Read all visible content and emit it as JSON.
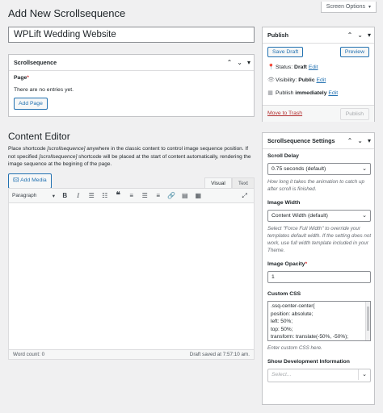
{
  "header": {
    "title": "Add New Scrollsequence",
    "screen_options": "Screen Options"
  },
  "post": {
    "title_value": "WPLift Wedding Website"
  },
  "scrollsequence_box": {
    "title": "Scrollsequence",
    "page_label": "Page",
    "required_mark": "*",
    "empty_text": "There are no entries yet.",
    "add_page_label": "Add Page"
  },
  "content_editor": {
    "title": "Content Editor",
    "help_1": "Place shortcode ",
    "help_code_1": "[scrollsequence]",
    "help_2": " anywhere in the classic content to control image sequence position. If not specified ",
    "help_code_2": "[scrollsequence]",
    "help_3": " shortcode will be placed at the start of content automatically, rendering the image sequence at the begining of the page.",
    "add_media_label": "Add Media",
    "tab_visual": "Visual",
    "tab_text": "Text",
    "format_select": "Paragraph",
    "word_count": "Word count: 0",
    "draft_saved": "Draft saved at 7:57:10 am."
  },
  "publish_box": {
    "title": "Publish",
    "save_draft": "Save Draft",
    "preview": "Preview",
    "status_label": "Status: ",
    "status_value": "Draft",
    "visibility_label": "Visibility: ",
    "visibility_value": "Public",
    "publish_label": "Publish ",
    "publish_value": "immediately",
    "edit": "Edit",
    "trash": "Move to Trash",
    "publish_btn": "Publish"
  },
  "settings_box": {
    "title": "Scrollsequence Settings",
    "scroll_delay_label": "Scroll Delay",
    "scroll_delay_value": "0.75 seconds (default)",
    "scroll_delay_desc": "How long it takes the animation to catch up after scroll is finished.",
    "image_width_label": "Image Width",
    "image_width_value": "Content Width (default)",
    "image_width_desc": "Select \"Force Full Width\" to override your templates default width. If the setting does not work, use full width template included in your Theme.",
    "opacity_label": "Image Opacity",
    "required_mark": "*",
    "opacity_value": "1",
    "css_label": "Custom CSS",
    "css_lines": [
      ".ssq-center-center{",
      "position: absolute;",
      "left: 50%;",
      "top: 50%;",
      "transform: translate(-50%, -50%);"
    ],
    "css_desc": "Enter custom CSS here.",
    "dev_info_label": "Show Development Information",
    "dev_info_placeholder": "Select..."
  },
  "colors": {
    "accent": "#2271b1",
    "delete": "#b32d2e"
  }
}
